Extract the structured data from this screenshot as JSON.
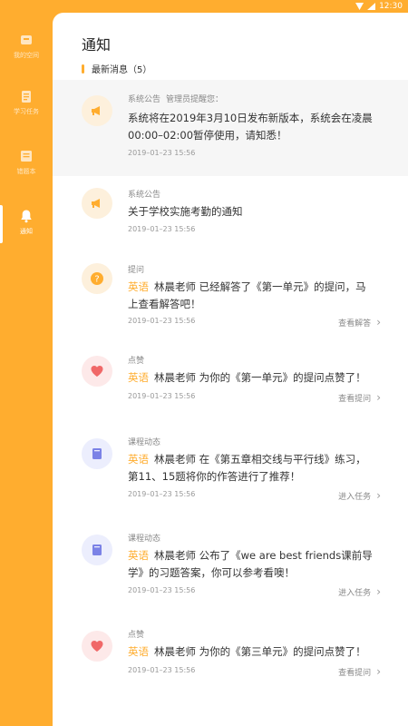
{
  "status": {
    "time": "12:30"
  },
  "sidebar": [
    {
      "label": "我的空间",
      "icon": "box-icon"
    },
    {
      "label": "学习任务",
      "icon": "clipboard-icon"
    },
    {
      "label": "错题本",
      "icon": "notebook-icon"
    },
    {
      "label": "通知",
      "icon": "bell-icon"
    }
  ],
  "header": {
    "title": "通知",
    "subtitle": "最新消息（5）"
  },
  "notifications": [
    {
      "type": "系统公告",
      "extra": "管理员提醒您：",
      "line1": "系统将在2019年3月10日发布新版本，系统会在凌晨",
      "line2": "00:00–02:00暂停使用，请知悉！",
      "time": "2019–01–23  15:56",
      "icon": "megaphone-icon"
    },
    {
      "type": "系统公告",
      "line1": "关于学校实施考勤的通知",
      "time": "2019–01–23  15:56",
      "icon": "megaphone-icon"
    },
    {
      "type": "提问",
      "subject": "英语",
      "line1": "林晨老师  已经解答了《第一单元》的提问，马",
      "line2": "上查看解答吧！",
      "time": "2019–01–23  15:56",
      "action": "查看解答",
      "icon": "question-icon"
    },
    {
      "type": "点赞",
      "subject": "英语",
      "line1": "林晨老师  为你的《第一单元》的提问点赞了！",
      "time": "2019–01–23  15:56",
      "action": "查看提问",
      "icon": "heart-icon"
    },
    {
      "type": "课程动态",
      "subject": "英语",
      "line1": "林晨老师  在《第五章相交线与平行线》练习，",
      "line2": "第11、15题将你的作答进行了推荐！",
      "time": "2019–01–23  15:56",
      "action": "进入任务",
      "icon": "book-icon"
    },
    {
      "type": "课程动态",
      "subject": "英语",
      "line1": "林晨老师  公布了《we are best friends课前导",
      "line2": "学》的习题答案，你可以参考看噢！",
      "time": "2019–01–23  15:56",
      "action": "进入任务",
      "icon": "book-icon"
    },
    {
      "type": "点赞",
      "subject": "英语",
      "line1": "林晨老师  为你的《第三单元》的提问点赞了！",
      "time": "2019–01–23  15:56",
      "action": "查看提问",
      "icon": "heart-icon"
    }
  ],
  "colors": {
    "accent": "#ffad2f",
    "heart": "#f06868",
    "book": "#7b82e6"
  }
}
